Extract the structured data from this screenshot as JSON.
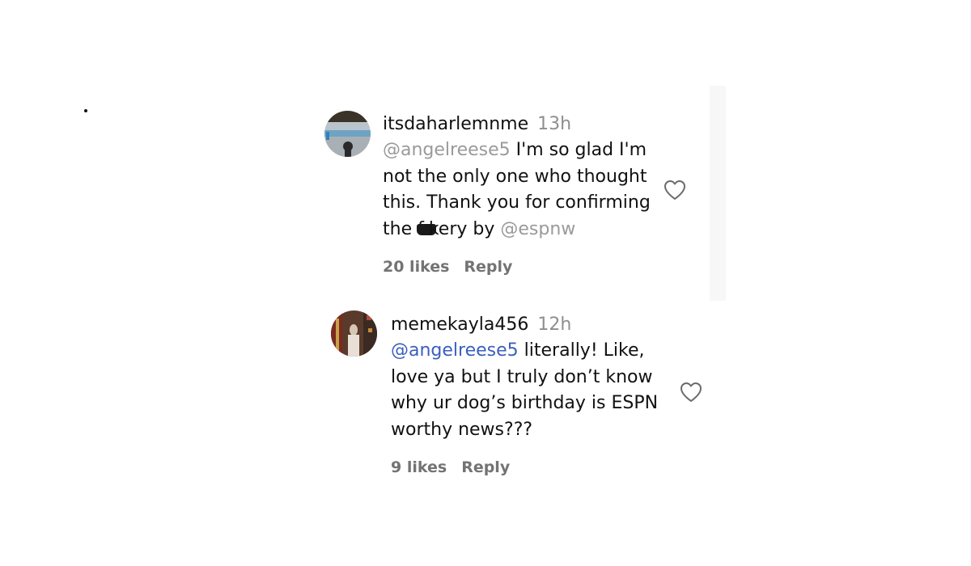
{
  "comments": [
    {
      "username": "itsdaharlemnme",
      "timestamp": "13h",
      "mention": "@angelreese5",
      "text_line1": " I'm so glad I'm",
      "text_line2": "not the only one who thought",
      "text_line3": "this. Thank you for confirming",
      "text_line4_start": "the f",
      "text_line4_after_censor": "kery by ",
      "mention_end": "@espnw",
      "likes": "20 likes",
      "reply": "Reply",
      "avatar_icon": "avatar-photo-icon",
      "heart_icon": "heart-outline-icon"
    },
    {
      "username": "memekayla456",
      "timestamp": "12h",
      "mention": "@angelreese5",
      "text_line1": " literally! Like,",
      "text_line2": "love ya but I truly don’t know",
      "text_line3": "why ur dog’s birthday is ESPN",
      "text_line4": "worthy news???",
      "likes": "9 likes",
      "reply": "Reply",
      "avatar_icon": "avatar-photo-icon",
      "heart_icon": "heart-outline-icon"
    }
  ],
  "colors": {
    "text": "#111111",
    "secondary": "#737373",
    "timestamp": "#8e8e8e",
    "mention_grey": "#9a9a9a",
    "mention_blue": "#3b5fbf"
  }
}
